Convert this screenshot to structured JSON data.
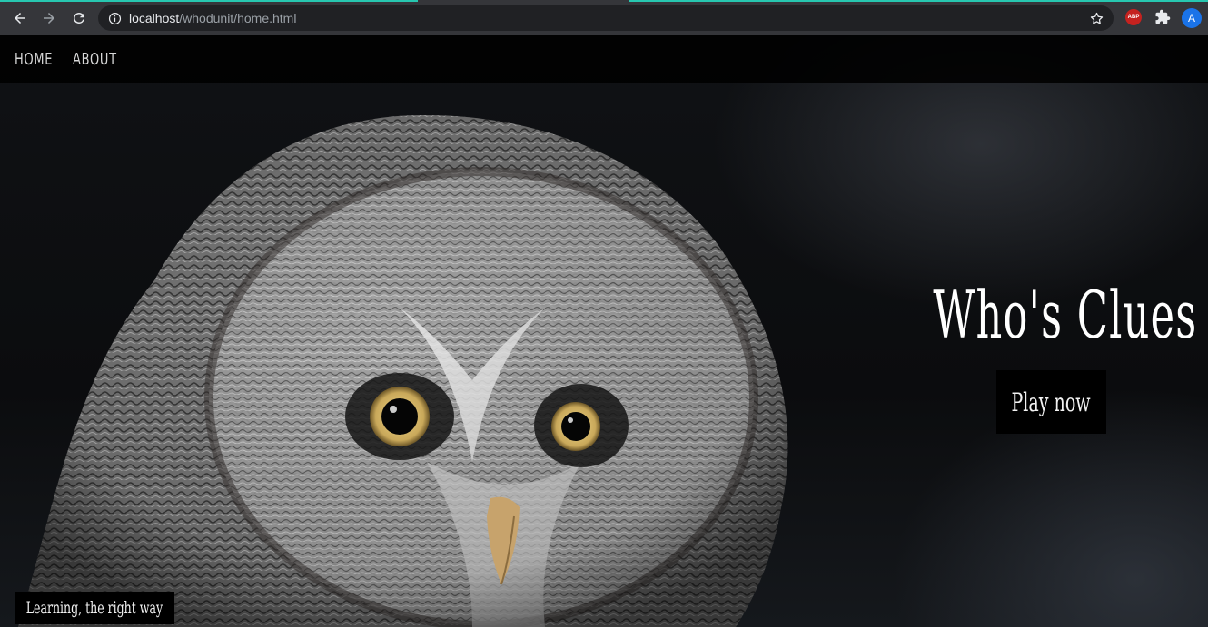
{
  "browser": {
    "url_host": "localhost",
    "url_path": "/whodunit/home.html",
    "profile_initial": "A",
    "adblock_label": "ABP",
    "icons": {
      "back": "arrow-left-icon",
      "forward": "arrow-right-icon",
      "reload": "reload-icon",
      "info": "info-icon",
      "bookmark": "star-icon",
      "extensions": "puzzle-icon"
    },
    "accent_color": "#27c7b0"
  },
  "nav": {
    "items": [
      {
        "label": "Home"
      },
      {
        "label": "About"
      }
    ]
  },
  "hero": {
    "title": "Who's Clues",
    "cta_label": "Play now",
    "tagline": "Learning, the right way"
  }
}
